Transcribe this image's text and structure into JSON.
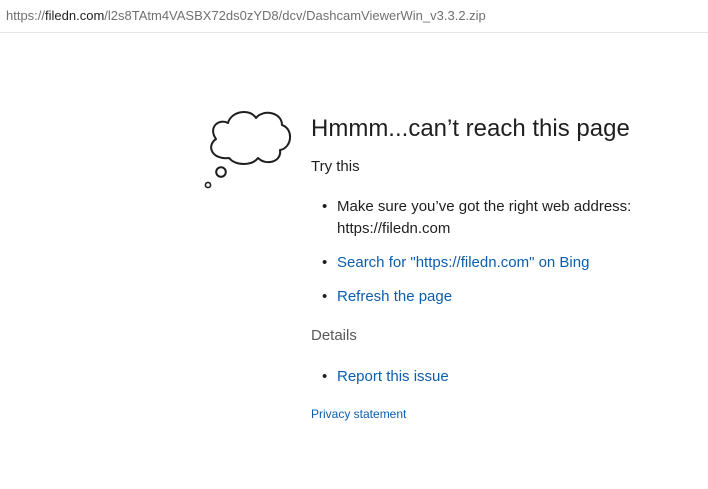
{
  "address_bar": {
    "scheme": "https://",
    "host": "filedn.com",
    "path": "/l2s8TAtm4VASBX72ds0zYD8/dcv/DashcamViewerWin_v3.3.2.zip"
  },
  "error": {
    "icon": "thought-cloud-icon",
    "title": "Hmmm...can’t reach this page",
    "try_this": "Try this",
    "suggestions": [
      {
        "text": "Make sure you’ve got the right web address: https://filedn.com"
      },
      {
        "text": "Search for \"https://filedn.com\" on Bing"
      },
      {
        "text": "Refresh the page"
      }
    ],
    "details_heading": "Details",
    "details_items": [
      {
        "text": "Report this issue"
      }
    ],
    "privacy_link": "Privacy statement"
  },
  "colors": {
    "link": "#0b5eaf",
    "text": "#1f1f1f",
    "muted": "#5a5a5a"
  }
}
